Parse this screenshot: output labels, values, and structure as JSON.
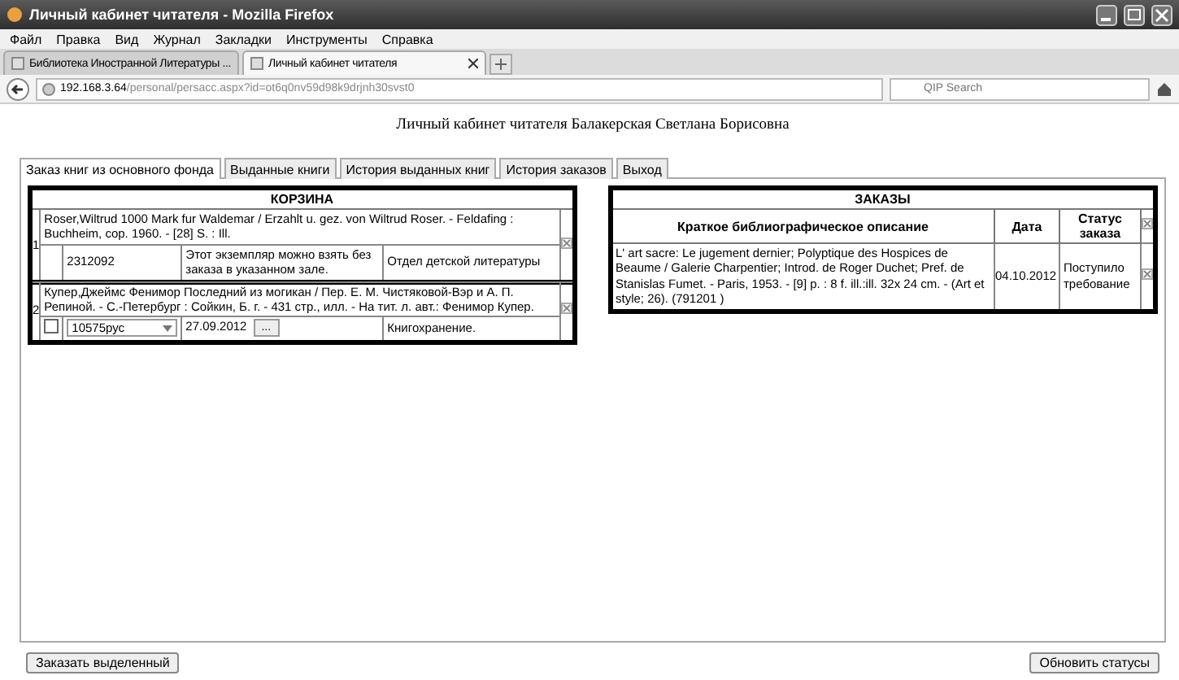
{
  "window": {
    "title": "Личный кабинет читателя - Mozilla Firefox"
  },
  "menu": [
    "Файл",
    "Правка",
    "Вид",
    "Журнал",
    "Закладки",
    "Инструменты",
    "Справка"
  ],
  "browser_tabs": [
    {
      "label": "Библиотека Иностранной Литературы ...",
      "selected": false
    },
    {
      "label": "Личный кабинет читателя",
      "selected": true
    }
  ],
  "address": {
    "host": "192.168.3.64",
    "path": "/personal/persacc.aspx?id=ot6q0nv59d98k9drjnh30svst0"
  },
  "search": {
    "placeholder": "QIP Search"
  },
  "heading": "Личный кабинет читателя Балакерская Светлана Борисовна",
  "tabs": [
    {
      "label": "Заказ книг из основного фонда",
      "selected": true
    },
    {
      "label": "Выданные книги",
      "selected": false
    },
    {
      "label": "История выданных книг",
      "selected": false
    },
    {
      "label": "История заказов",
      "selected": false
    },
    {
      "label": "Выход",
      "selected": false
    }
  ],
  "basket": {
    "title": "КОРЗИНА",
    "items": [
      {
        "number": "1",
        "description": "Roser,Wiltrud 1000 Mark fur Waldemar / Erzahlt u. gez. von Wiltrud Roser. - Feldafing : Buchheim, cop. 1960. - [28] S. : Ill.",
        "copy": {
          "kind": "info",
          "inventory": "2312092",
          "note": "Этот экземпляр можно взять без заказа в указанном зале.",
          "location": "Отдел детской литературы"
        }
      },
      {
        "number": "2",
        "description": "Купер,Джеймс Фенимор Последний из могикан / Пер. Е. М. Чистяковой-Вэр и А. П. Репиной. - С.-Петербург : Сойкин, Б. г. - 431 стр., илл. - На тит. л. авт.: Фенимор Купер.",
        "copy": {
          "kind": "order",
          "checked": false,
          "inventory": "10575рус",
          "date": "27.09.2012",
          "button": "...",
          "location": "Книгохранение."
        }
      }
    ]
  },
  "orders": {
    "title": "ЗАКАЗЫ",
    "columns": [
      "Краткое библиографическое описание",
      "Дата",
      "Статус заказа"
    ],
    "rows": [
      {
        "description": "L' art sacre: Le jugement dernier; Polyptique des Hospices de Beaume / Galerie Charpentier; Introd. de Roger Duchet; Pref. de Stanislas Fumet. - Paris, 1953. - [9] p. : 8 f. ill.:ill. 32x 24 cm. - (Art et style; 26). (791201 )",
        "date": "04.10.2012",
        "status": "Поступило требование"
      }
    ]
  },
  "buttons": [
    "Заказать выделенный",
    "Обновить статусы"
  ]
}
